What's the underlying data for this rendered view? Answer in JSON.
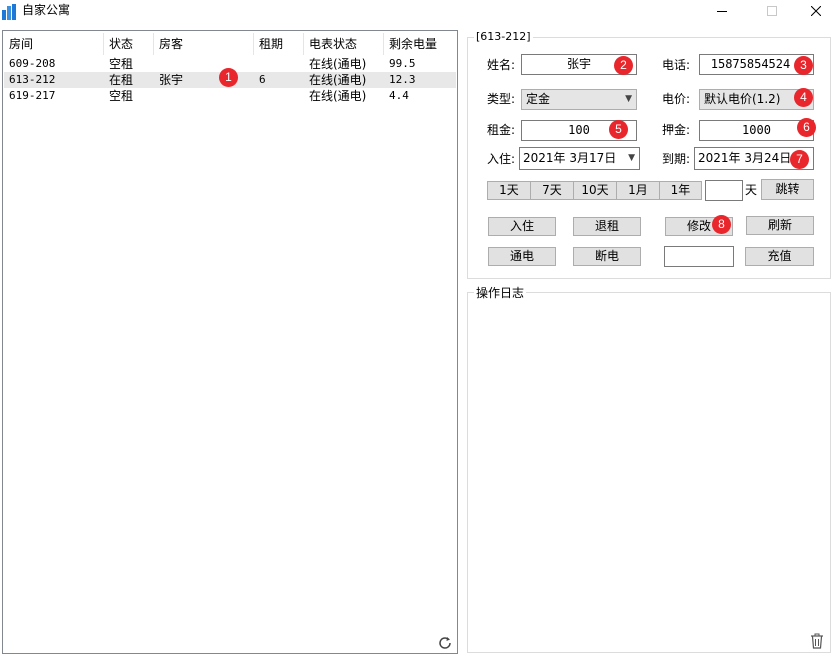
{
  "window": {
    "title": "自家公寓"
  },
  "list": {
    "columns": [
      "房间",
      "状态",
      "房客",
      "租期",
      "电表状态",
      "剩余电量"
    ],
    "rows": [
      {
        "room": "609-208",
        "status": "空租",
        "tenant": "",
        "term": "",
        "meter": "在线(通电)",
        "power": "99.5"
      },
      {
        "room": "613-212",
        "status": "在租",
        "tenant": "张宇",
        "term": "6",
        "meter": "在线(通电)",
        "power": "12.3"
      },
      {
        "room": "619-217",
        "status": "空租",
        "tenant": "",
        "term": "",
        "meter": "在线(通电)",
        "power": "4.4"
      }
    ]
  },
  "detail": {
    "group_title": "[613-212]",
    "name_label": "姓名:",
    "name_value": "张宇",
    "phone_label": "电话:",
    "phone_value": "15875854524",
    "type_label": "类型:",
    "type_value": "定金",
    "price_label": "电价:",
    "price_value": "默认电价(1.2)",
    "rent_label": "租金:",
    "rent_value": "100",
    "deposit_label": "押金:",
    "deposit_value": "1000",
    "checkin_label": "入住:",
    "checkin_value": "2021年  3月17日",
    "expire_label": "到期:",
    "expire_value": "2021年  3月24日",
    "quick_periods": [
      "1天",
      "7天",
      "10天",
      "1月",
      "1年"
    ],
    "days_unit": "天",
    "jump_label": "跳转",
    "buttons": {
      "checkin": "入住",
      "checkout": "退租",
      "modify": "修改",
      "refresh": "刷新",
      "power_on": "通电",
      "power_off": "断电",
      "recharge": "充值"
    }
  },
  "log": {
    "title": "操作日志"
  },
  "badges": [
    "1",
    "2",
    "3",
    "4",
    "5",
    "6",
    "7",
    "8"
  ],
  "colors": {
    "badge": "#e8262b",
    "selected_row": "#e8e8e8",
    "icon_blue": "#1e78d7"
  }
}
